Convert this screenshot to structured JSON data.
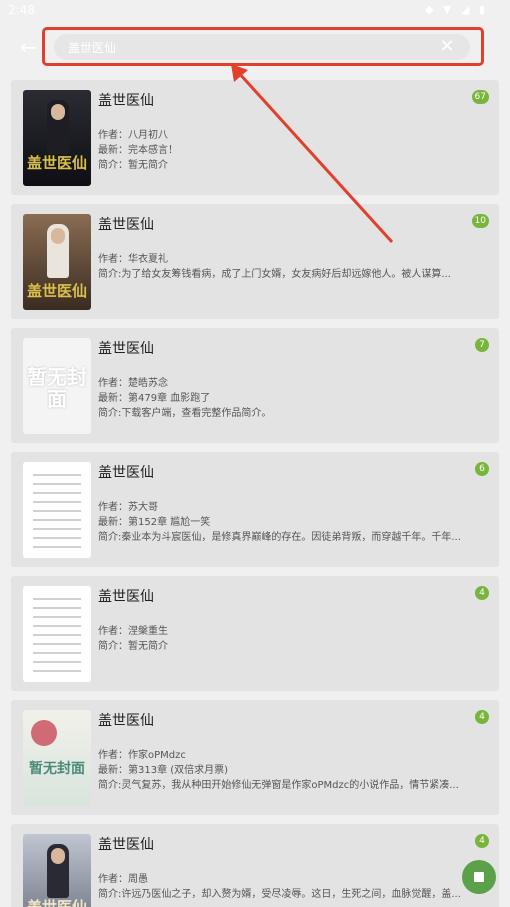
{
  "status_bar": {
    "time": "2:48",
    "icons": "◆ ▼ ◢ ▮"
  },
  "search": {
    "query": "盖世医仙",
    "clear_label": "✕",
    "back_label": "←"
  },
  "results": [
    {
      "title": "盖世医仙",
      "count": "67",
      "cover_text": "盖世医仙",
      "lines": [
        "作者：八月初八",
        "最新：完本感言！",
        "简介：暂无简介"
      ]
    },
    {
      "title": "盖世医仙",
      "count": "10",
      "cover_text": "盖世医仙",
      "lines": [
        "作者：华衣夏礼",
        "简介:为了给女友筹钱看病，成了上门女婿，女友病好后却远嫁他人。被人谋算..."
      ]
    },
    {
      "title": "盖世医仙",
      "count": "7",
      "cover_text": "暂无封面",
      "lines": [
        "作者：楚皓苏念",
        "最新：第479章 血影跑了",
        "简介:下载客户端，查看完整作品简介。"
      ]
    },
    {
      "title": "盖世医仙",
      "count": "6",
      "lines": [
        "作者：苏大哥",
        "最新：第152章 尴尬一笑",
        "简介:秦业本为斗宸医仙，是修真界巅峰的存在。因徒弟背叛，而穿越千年。千年..."
      ]
    },
    {
      "title": "盖世医仙",
      "count": "4",
      "lines": [
        "作者：涅槃重生",
        "简介：暂无简介"
      ]
    },
    {
      "title": "盖世医仙",
      "count": "4",
      "cover_text": "暂无封面",
      "lines": [
        "作者：作家oPMdzc",
        "最新：第313章 (双倍求月票)",
        "简介:灵气复苏，我从种田开始修仙无弹窗是作家oPMdzc的小说作品，情节紧凑..."
      ]
    },
    {
      "title": "盖世医仙",
      "count": "4",
      "cover_text": "盖世医仙",
      "lines": [
        "作者：周愚",
        "简介:许远乃医仙之子，却入赘为婿，受尽凌辱。这日，生死之间，血脉觉醒，盖..."
      ]
    }
  ]
}
